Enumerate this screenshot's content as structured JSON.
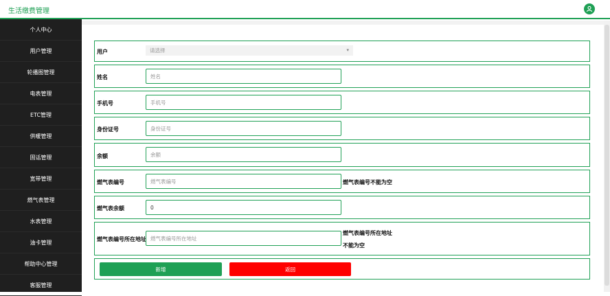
{
  "header": {
    "title": "生活缴费管理",
    "avatar_icon": "user-icon"
  },
  "sidebar": {
    "items": [
      {
        "label": "个人中心"
      },
      {
        "label": "用户管理"
      },
      {
        "label": "轮播图管理"
      },
      {
        "label": "电表管理"
      },
      {
        "label": "ETC管理"
      },
      {
        "label": "供暖管理"
      },
      {
        "label": "固话管理"
      },
      {
        "label": "宽带管理"
      },
      {
        "label": "燃气表管理"
      },
      {
        "label": "水表管理"
      },
      {
        "label": "油卡管理"
      },
      {
        "label": "帮助中心管理"
      },
      {
        "label": "客服管理"
      }
    ]
  },
  "form": {
    "user": {
      "label": "用户",
      "placeholder": "请选择"
    },
    "name": {
      "label": "姓名",
      "placeholder": "姓名"
    },
    "phone": {
      "label": "手机号",
      "placeholder": "手机号"
    },
    "idcard": {
      "label": "身份证号",
      "placeholder": "身份证号"
    },
    "balance": {
      "label": "余额",
      "placeholder": "余额"
    },
    "gas_no": {
      "label": "燃气表编号",
      "placeholder": "燃气表编号",
      "error": "燃气表编号不能为空"
    },
    "gas_balance": {
      "label": "燃气表余额",
      "value": "0"
    },
    "gas_address": {
      "label": "燃气表编号所在地址",
      "placeholder": "燃气表编号所在地址",
      "error_line1": "燃气表编号所在地址",
      "error_line2": "不能为空"
    },
    "actions": {
      "add_label": "新增",
      "back_label": "返回"
    }
  },
  "colors": {
    "accent": "#1fa055",
    "danger": "#ff0000",
    "sidebar_bg": "#1f1f1f"
  }
}
